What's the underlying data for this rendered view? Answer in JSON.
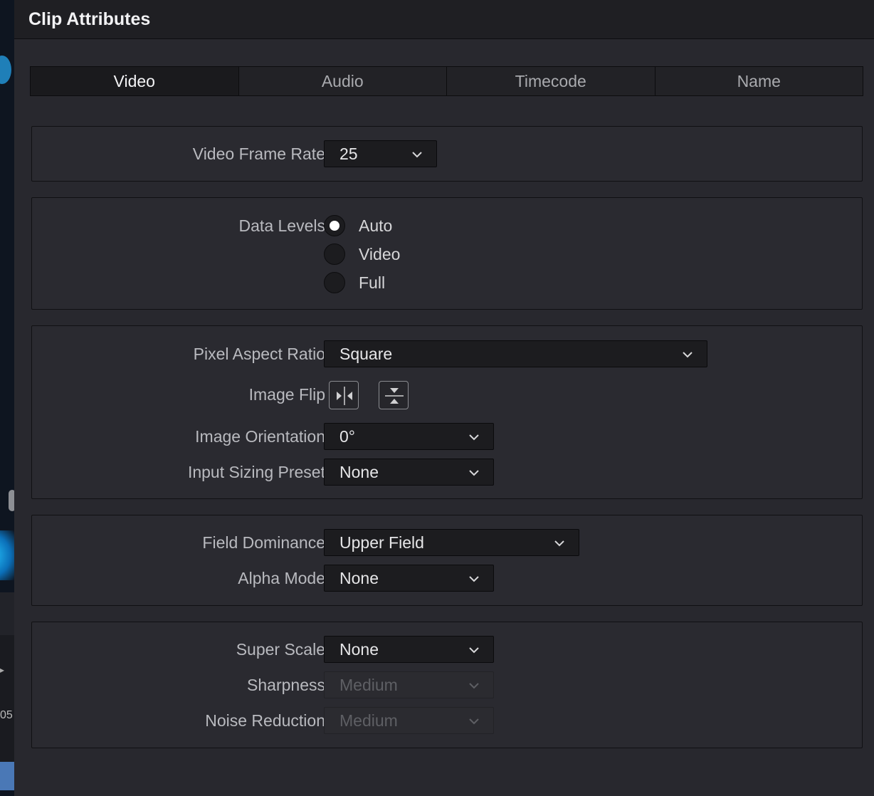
{
  "dialog": {
    "title": "Clip Attributes"
  },
  "background": {
    "timeline_number": "05"
  },
  "tabs": [
    {
      "label": "Video",
      "active": true
    },
    {
      "label": "Audio",
      "active": false
    },
    {
      "label": "Timecode",
      "active": false
    },
    {
      "label": "Name",
      "active": false
    }
  ],
  "frame_rate": {
    "label": "Video Frame Rate",
    "value": "25"
  },
  "data_levels": {
    "label": "Data Levels",
    "options": [
      {
        "label": "Auto",
        "selected": true
      },
      {
        "label": "Video",
        "selected": false
      },
      {
        "label": "Full",
        "selected": false
      }
    ]
  },
  "geometry": {
    "pixel_aspect_ratio": {
      "label": "Pixel Aspect Ratio",
      "value": "Square"
    },
    "image_flip": {
      "label": "Image Flip",
      "icons": [
        "flip-horizontal-icon",
        "flip-vertical-icon"
      ]
    },
    "image_orientation": {
      "label": "Image Orientation",
      "value": "0°"
    },
    "input_sizing_preset": {
      "label": "Input Sizing Preset",
      "value": "None"
    }
  },
  "field": {
    "field_dominance": {
      "label": "Field Dominance",
      "value": "Upper Field"
    },
    "alpha_mode": {
      "label": "Alpha Mode",
      "value": "None"
    }
  },
  "scaling": {
    "super_scale": {
      "label": "Super Scale",
      "value": "None"
    },
    "sharpness": {
      "label": "Sharpness",
      "value": "Medium",
      "disabled": true
    },
    "noise_reduction": {
      "label": "Noise Reduction",
      "value": "Medium",
      "disabled": true
    }
  },
  "colors": {
    "panel": "#28282e",
    "titlebar": "#1f1f23",
    "dropdown": "#1c1c1f",
    "text": "#d8d8da",
    "disabled_text": "#5e5f64"
  }
}
